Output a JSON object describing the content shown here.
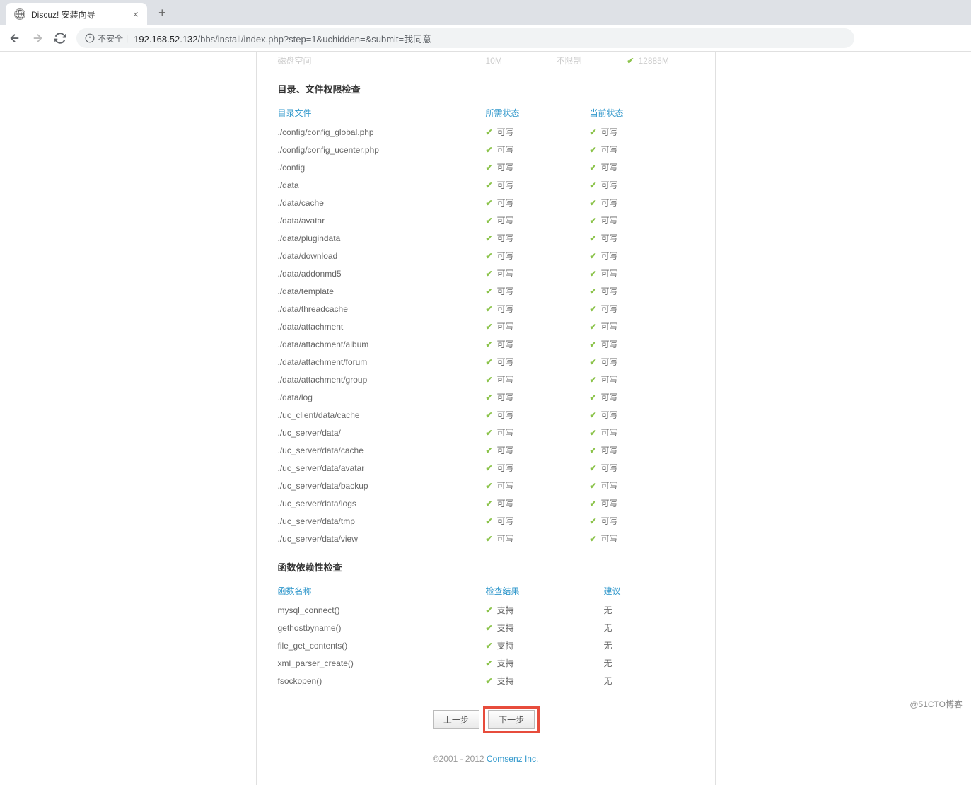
{
  "browser": {
    "tab_title": "Discuz! 安装向导",
    "security_label": "不安全",
    "url_host": "192.168.52.132",
    "url_path": "/bbs/install/index.php?step=1&uchidden=&submit=我同意"
  },
  "env_partial": {
    "label": "磁盘空间",
    "required": "10M",
    "limit": "不限制",
    "current": "12885M"
  },
  "perm_section": {
    "title": "目录、文件权限检查",
    "headers": {
      "col1": "目录文件",
      "col2": "所需状态",
      "col3": "当前状态"
    },
    "writable_label": "可写",
    "rows": [
      "./config/config_global.php",
      "./config/config_ucenter.php",
      "./config",
      "./data",
      "./data/cache",
      "./data/avatar",
      "./data/plugindata",
      "./data/download",
      "./data/addonmd5",
      "./data/template",
      "./data/threadcache",
      "./data/attachment",
      "./data/attachment/album",
      "./data/attachment/forum",
      "./data/attachment/group",
      "./data/log",
      "./uc_client/data/cache",
      "./uc_server/data/",
      "./uc_server/data/cache",
      "./uc_server/data/avatar",
      "./uc_server/data/backup",
      "./uc_server/data/logs",
      "./uc_server/data/tmp",
      "./uc_server/data/view"
    ]
  },
  "func_section": {
    "title": "函数依赖性检查",
    "headers": {
      "col1": "函数名称",
      "col2": "检查结果",
      "col3": "建议"
    },
    "supported_label": "支持",
    "none_label": "无",
    "rows": [
      "mysql_connect()",
      "gethostbyname()",
      "file_get_contents()",
      "xml_parser_create()",
      "fsockopen()"
    ]
  },
  "buttons": {
    "prev": "上一步",
    "next": "下一步"
  },
  "footer": {
    "copyright": "©2001 - 2012 ",
    "company": "Comsenz Inc."
  },
  "watermark": "@51CTO博客"
}
